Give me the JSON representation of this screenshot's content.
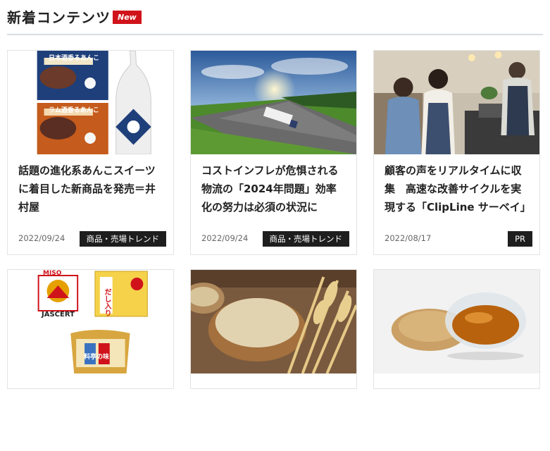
{
  "header": {
    "title": "新着コンテンツ",
    "badge": "New"
  },
  "cards": [
    {
      "title": "話題の進化系あんこスイーツに着目した新商品を発売＝井村屋",
      "date": "2022/09/24",
      "tag": "商品・売場トレンド",
      "image": "あんこスイーツ商品"
    },
    {
      "title": "コストインフレが危惧される物流の「2024年問題」効率化の努力は必須の状況に",
      "date": "2022/09/24",
      "tag": "商品・売場トレンド",
      "image": "高速道路を走るトラック"
    },
    {
      "title": "顧客の声をリアルタイムに収集　高速な改善サイクルを実現する「ClipLine サーベイ」",
      "date": "2022/08/17",
      "tag": "PR",
      "image": "カフェで接客するスタッフ"
    },
    {
      "title": "",
      "date": "",
      "tag": "",
      "image": "味噌商品"
    },
    {
      "title": "",
      "date": "",
      "tag": "",
      "image": "オーツ麦と麦穂"
    },
    {
      "title": "",
      "date": "",
      "tag": "",
      "image": "ごまとごま油"
    }
  ],
  "product_labels": {
    "anko_top": "日本酒香るあんこ",
    "anko_bottom": "ラム酒香るあんこ",
    "jascert": "JASCERT",
    "miso": "MISO",
    "dashi": "だし入り",
    "ryotei": "料亭の味"
  },
  "colors": {
    "accent": "#d0131b",
    "tag_bg": "#1e1e1e",
    "divider": "#d9dde3"
  }
}
